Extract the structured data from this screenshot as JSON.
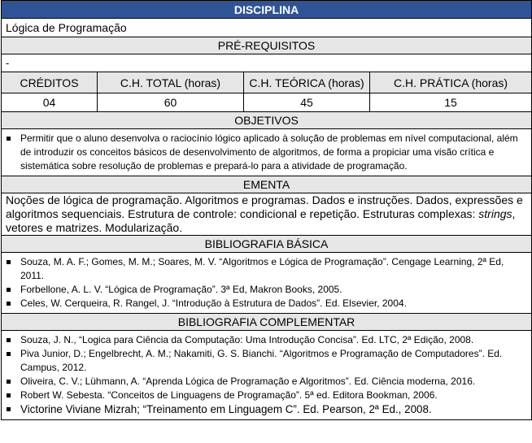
{
  "disciplina": {
    "header": "DISCIPLINA",
    "name": "Lógica de Programação"
  },
  "prerequisitos": {
    "header": "PRÉ-REQUISITOS",
    "value": "-"
  },
  "workload": {
    "columns": [
      "CRÉDITOS",
      "C.H. TOTAL (horas)",
      "C.H. TEÓRICA (horas)",
      "C.H. PRÁTICA (horas)"
    ],
    "values": [
      "04",
      "60",
      "45",
      "15"
    ]
  },
  "objetivos": {
    "header": "OBJETIVOS",
    "items": [
      "Permitir que o aluno desenvolva o raciocínio lógico aplicado à solução de problemas em nível computacional, além de introduzir os conceitos básicos de desenvolvimento de algoritmos, de forma a propiciar uma visão crítica e sistemática sobre resolução de problemas e prepará-lo para a atividade de programação."
    ]
  },
  "ementa": {
    "header": "EMENTA",
    "text_before": "Noções de lógica de programação. Algoritmos e programas. Dados e instruções. Dados, expressões e algoritmos sequenciais. Estrutura de controle: condicional e repetição. Estruturas complexas: ",
    "text_italic": "strings",
    "text_after": ", vetores e matrizes. Modularização."
  },
  "bibliografia_basica": {
    "header": "BIBLIOGRAFIA BÁSICA",
    "items": [
      "Souza, M. A. F.; Gomes, M. M.; Soares, M. V. “Algoritmos e Lógica de Programação”. Cengage Learning, 2ª Ed, 2011.",
      "Forbellone, A. L. V. “Lógica de Programação”. 3ª Ed, Makron Books, 2005.",
      "Celes, W. Cerqueira, R. Rangel, J. “Introdução à Estrutura de Dados”. Ed. Elsevier, 2004."
    ]
  },
  "bibliografia_complementar": {
    "header": "BIBLIOGRAFIA COMPLEMENTAR",
    "items": [
      "Souza, J. N., “Logica para Ciência da Computação: Uma Introdução Concisa”. Ed. LTC, 2ª Edição, 2008.",
      "Piva Junior, D.; Engelbrecht, A. M.; Nakamiti, G. S. Bianchi. “Algoritmos e Programação de Computadores”. Ed. Campus, 2012.",
      "Oliveira, C. V.; Lühmann, A. “Aprenda Lógica de Programação e Algoritmos”. Ed. Ciência moderna, 2016.",
      "Robert W. Sebesta. “Conceitos de Linguagens de Programação”. 5ª ed. Editora Bookman, 2006.",
      "Victorine Viviane Mizrah; “Treinamento em Linguagem C”. Ed. Pearson, 2ª Ed., 2008."
    ]
  },
  "colors": {
    "header_blue": "#2f5496",
    "header_gray": "#e6e6e6"
  }
}
